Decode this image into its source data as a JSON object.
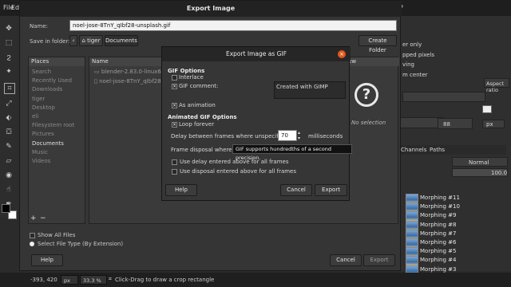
{
  "gimp": {
    "menu": [
      "File",
      "Edi"
    ],
    "right_menu_letter": "P",
    "status": {
      "coords": "-393, 420",
      "unit": "px",
      "zoom": "33.3 %",
      "hint": "Click-Drag to draw a crop rectangle"
    },
    "dock": {
      "opt1": "er only",
      "opt2": "pped pixels",
      "opt3": "ving",
      "opt4": "m center",
      "aspect": "Aspect ratio",
      "unit": "px",
      "num": "88",
      "tabs": {
        "channels": "Channels",
        "paths": "Paths"
      },
      "mode": "Normal",
      "opacity": "100.0",
      "layers": [
        "Morphing #11",
        "Morphing #10",
        "Morphing #9",
        "Morphing #8",
        "Morphing #7",
        "Morphing #6",
        "Morphing #5",
        "Morphing #4",
        "Morphing #3"
      ]
    }
  },
  "export": {
    "title": "Export Image",
    "name_label": "Name:",
    "name_value": "noel-jose-8TnY_qIbf28-unsplash.gif",
    "folder_label": "Save in folder:",
    "crumbs": [
      "tiger",
      "Documents"
    ],
    "create_folder": "Create Folder",
    "places_header": "Places",
    "places": [
      "Search",
      "Recently Used",
      "Downloads",
      "tiger",
      "Desktop",
      "eli",
      "Filesystem root",
      "Pictures",
      "Documents",
      "Music",
      "Videos"
    ],
    "name_col": "Name",
    "preview_col": "view",
    "files": [
      "blender-2.83.0-linux64",
      "noel-jose-8TnY_qIbf28-uns"
    ],
    "no_selection": "No selection",
    "show_all": "Show All Files",
    "select_type": "Select File Type (By Extension)",
    "help": "Help",
    "cancel": "Cancel",
    "export": "Export"
  },
  "gif": {
    "title": "Export Image as GIF",
    "options_header": "GIF Options",
    "interlace": "Interlace",
    "comment_label": "GIF comment:",
    "comment_value": "Created with GIMP",
    "as_animation": "As animation",
    "anim_header": "Animated GIF Options",
    "loop_forever": "Loop forever",
    "delay_label": "Delay between frames where unspecified:",
    "delay_value": "70",
    "ms": "milliseconds",
    "disposal_label": "Frame disposal where u",
    "use_delay": "Use delay entered above for all frames",
    "use_disposal": "Use disposal entered above for all frames",
    "tooltip": "GIF supports hundredths of a second precision.",
    "help": "Help",
    "cancel": "Cancel",
    "export": "Export"
  }
}
